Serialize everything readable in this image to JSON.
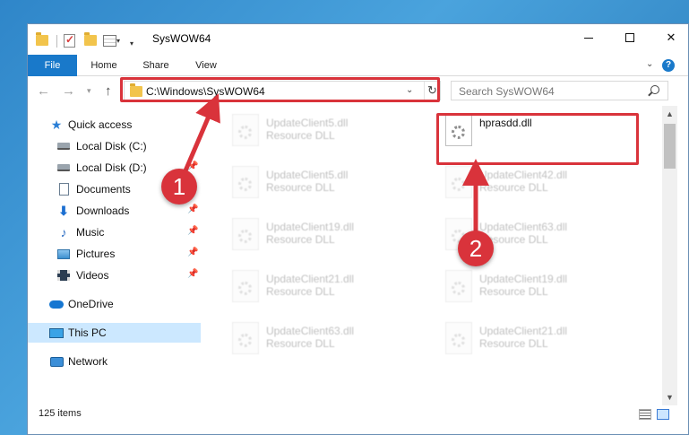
{
  "window": {
    "title": "SysWOW64",
    "controls": {
      "minimize": "minimize-icon",
      "maximize": "maximize-icon",
      "close": "✕"
    }
  },
  "ribbon": {
    "tabs": [
      "File",
      "Home",
      "Share",
      "View"
    ],
    "help": "?"
  },
  "navigation": {
    "address": "C:\\Windows\\SysWOW64",
    "search_placeholder": "Search SysWOW64"
  },
  "sidebar": {
    "items": [
      {
        "label": "Quick access",
        "icon": "star-icon",
        "pinned": false
      },
      {
        "label": "Local Disk (C:)",
        "icon": "drive-icon",
        "pinned": false
      },
      {
        "label": "Local Disk (D:)",
        "icon": "drive-icon",
        "pinned": true
      },
      {
        "label": "Documents",
        "icon": "documents-icon",
        "pinned": false
      },
      {
        "label": "Downloads",
        "icon": "download-icon",
        "pinned": true
      },
      {
        "label": "Music",
        "icon": "music-icon",
        "pinned": true
      },
      {
        "label": "Pictures",
        "icon": "pictures-icon",
        "pinned": true
      },
      {
        "label": "Videos",
        "icon": "videos-icon",
        "pinned": true
      },
      {
        "label": "OneDrive",
        "icon": "cloud-icon",
        "pinned": false
      },
      {
        "label": "This PC",
        "icon": "computer-icon",
        "pinned": false,
        "selected": true
      },
      {
        "label": "Network",
        "icon": "network-icon",
        "pinned": false
      }
    ]
  },
  "files": [
    {
      "name": "UpdateClient5.dll",
      "type": "Resource DLL"
    },
    {
      "name": "hprasdd.dll",
      "type": ""
    },
    {
      "name": "UpdateClient5.dll",
      "type": "Resource DLL"
    },
    {
      "name": "UpdateClient42.dll",
      "type": "Resource DLL"
    },
    {
      "name": "UpdateClient19.dll",
      "type": "Resource DLL"
    },
    {
      "name": "UpdateClient63.dll",
      "type": "Resource DLL"
    },
    {
      "name": "UpdateClient21.dll",
      "type": "Resource DLL"
    },
    {
      "name": "UpdateClient19.dll",
      "type": "Resource DLL"
    },
    {
      "name": "UpdateClient63.dll",
      "type": "Resource DLL"
    },
    {
      "name": "UpdateClient21.dll",
      "type": "Resource DLL"
    }
  ],
  "status": {
    "item_count": "125 items"
  },
  "annotations": {
    "step1": "1",
    "step2": "2",
    "highlight_color": "#d9333b"
  },
  "colors": {
    "accent": "#1979ca",
    "selection": "#cce8ff"
  }
}
